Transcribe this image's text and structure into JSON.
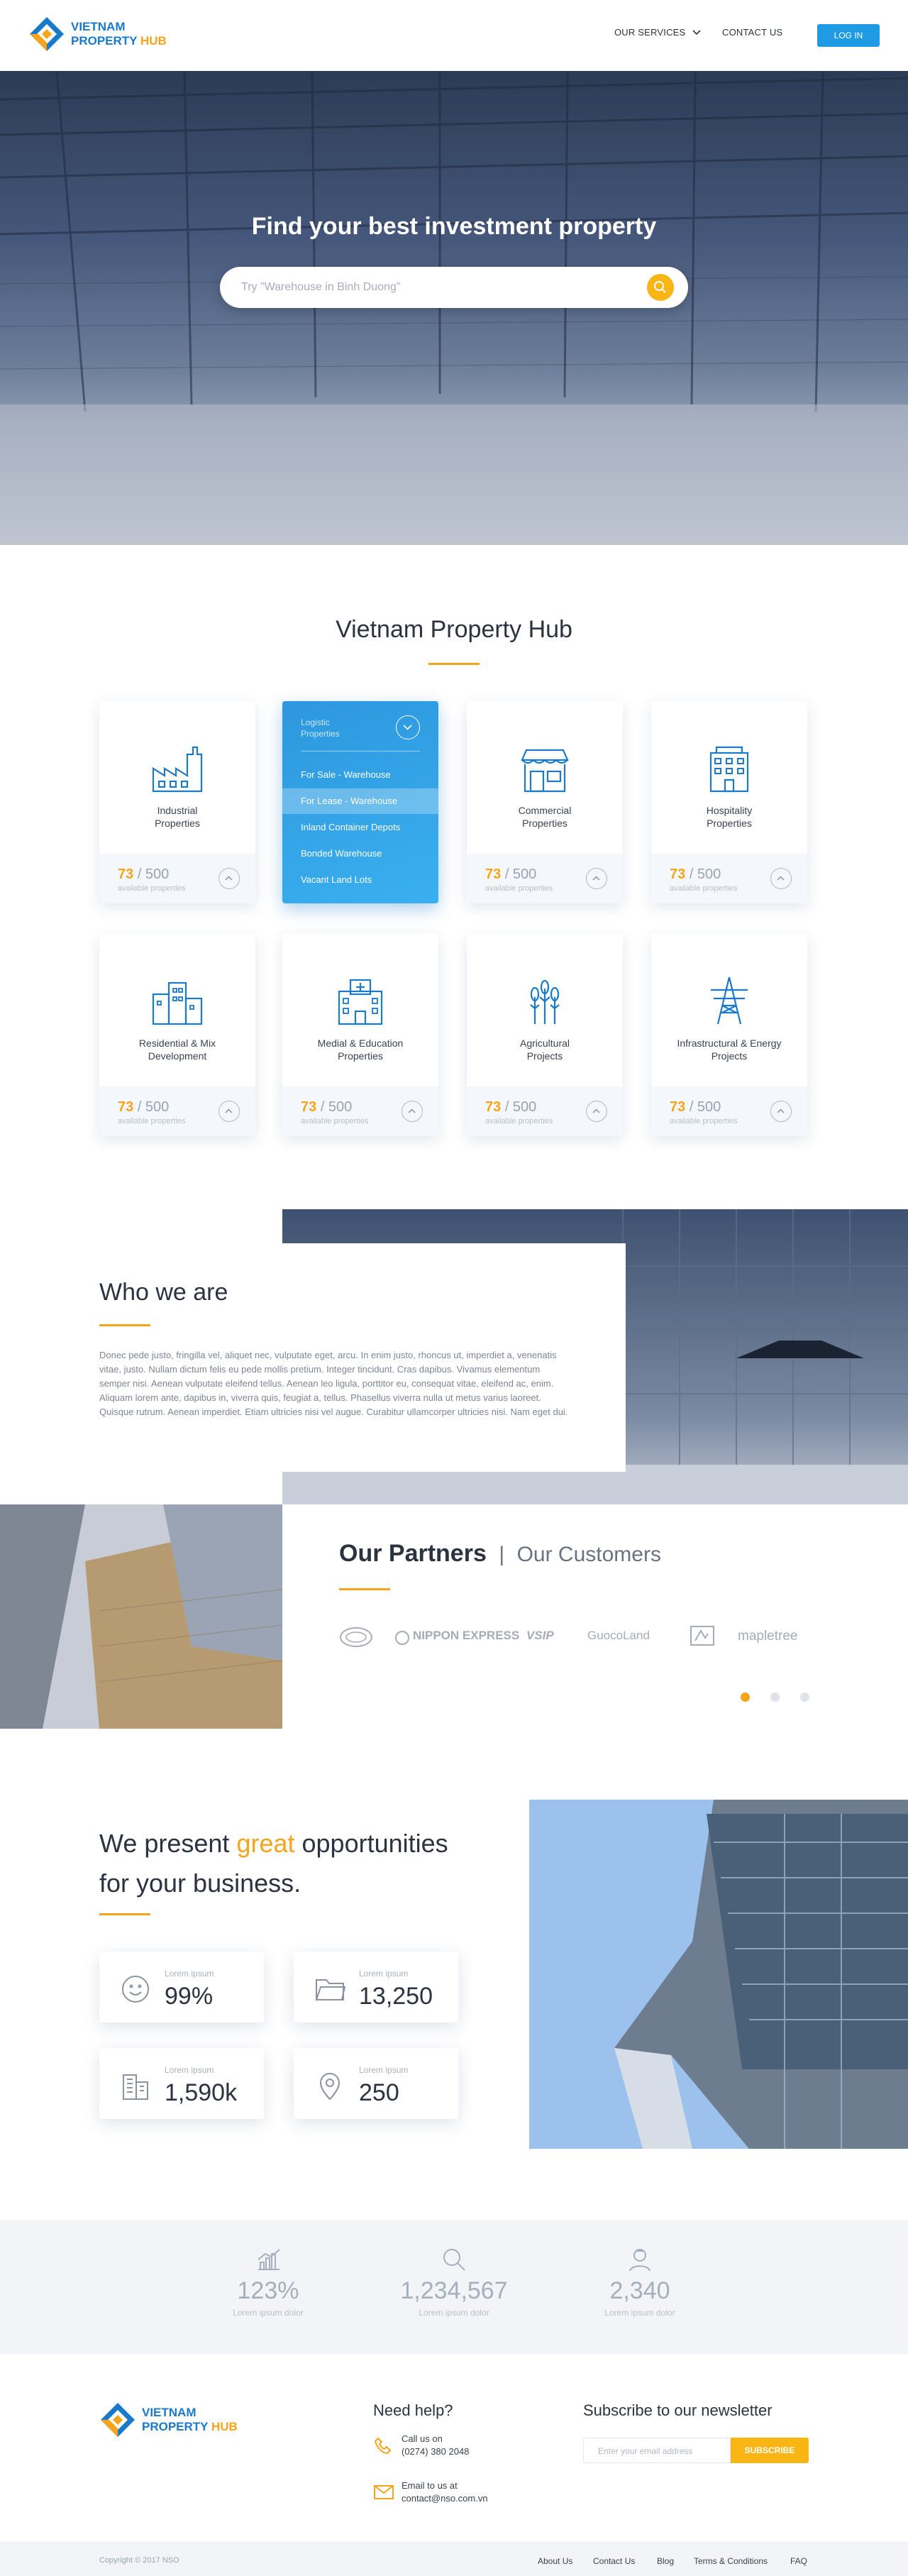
{
  "header": {
    "logo_line1": "VIETNAM",
    "logo_line2a": "PROPERTY",
    "logo_line2b": "HUB",
    "nav_services": "OUR SERVICES",
    "nav_contact": "CONTACT US",
    "login": "LOG IN"
  },
  "hero": {
    "title": "Find your best investment property",
    "search_placeholder": "Try \"Warehouse in Binh Duong\""
  },
  "properties": {
    "title": "Vietnam Property Hub",
    "cards": [
      {
        "name": "Industrial\nProperties",
        "count": "73",
        "total": "/ 500",
        "avail": "available properties",
        "icon": "factory-icon"
      },
      {
        "name": "Commercial\nProperties",
        "count": "73",
        "total": "/ 500",
        "avail": "available properties",
        "icon": "shop-icon"
      },
      {
        "name": "Hospitality\nProperties",
        "count": "73",
        "total": "/ 500",
        "avail": "available properties",
        "icon": "hotel-icon"
      },
      {
        "name": "Residential & Mix\nDevelopment",
        "count": "73",
        "total": "/ 500",
        "avail": "available properties",
        "icon": "residential-icon"
      },
      {
        "name": "Medial & Education\nProperties",
        "count": "73",
        "total": "/ 500",
        "avail": "available properties",
        "icon": "hospital-icon"
      },
      {
        "name": "Agricultural\nProjects",
        "count": "73",
        "total": "/ 500",
        "avail": "available properties",
        "icon": "wheat-icon"
      },
      {
        "name": "Infrastructural & Energy\nProjects",
        "count": "73",
        "total": "/ 500",
        "avail": "available properties",
        "icon": "power-tower-icon"
      }
    ],
    "dropdown": {
      "header": "Logistic\nProperties",
      "items": [
        "For Sale - Warehouse",
        "For Lease - Warehouse",
        "Inland Container Depots",
        "Bonded Warehouse",
        "Vacant Land Lots"
      ],
      "active_index": 1
    }
  },
  "who": {
    "title": "Who we are",
    "body": "Donec pede justo, fringilla vel, aliquet nec, vulputate eget, arcu. In enim justo, rhoncus ut, imperdiet a, venenatis vitae, justo. Nullam dictum felis eu pede mollis pretium. Integer tincidunt. Cras dapibus. Vivamus elementum semper nisi. Aenean vulputate eleifend tellus. Aenean leo ligula, porttitor eu, consequat vitae, eleifend ac, enim. Aliquam lorem ante, dapibus in, viverra quis, feugiat a, tellus. Phasellus viverra nulla ut metus varius laoreet. Quisque rutrum. Aenean imperdiet. Etiam ultricies nisi vel augue. Curabitur ullamcorper ultricies nisi. Nam eget dui."
  },
  "partners": {
    "title": "Our Partners",
    "separator": "|",
    "subtitle": "Our Customers",
    "logos": [
      "NIPPON EXPRESS",
      "VSIP",
      "GuocoLand",
      "mapletree"
    ]
  },
  "opportunities": {
    "line1a": "We present ",
    "line1b": "great",
    "line1c": " opportunities",
    "line2": "for your business.",
    "stats": [
      {
        "label": "Lorem ipsum",
        "value": "99%",
        "icon": "smile-icon"
      },
      {
        "label": "Lorem ipsum",
        "value": "13,250",
        "icon": "folder-icon"
      },
      {
        "label": "Lorem ipsum",
        "value": "1,590k",
        "icon": "buildings-icon"
      },
      {
        "label": "Lorem ipsum",
        "value": "250",
        "icon": "location-pin-icon"
      }
    ]
  },
  "bigstats": [
    {
      "value": "123%",
      "label": "Lorem ipsum dolor",
      "icon": "bar-chart-icon"
    },
    {
      "value": "1,234,567",
      "label": "Lorem ipsum dolor",
      "icon": "magnifier-icon"
    },
    {
      "value": "2,340",
      "label": "Lorem ipsum dolor",
      "icon": "user-icon"
    }
  ],
  "footer": {
    "help_title": "Need help?",
    "call_label": "Call us on",
    "phone": "(0274) 380 2048",
    "email_label": "Email to us at",
    "email": "contact@nso.com.vn",
    "newsletter_title": "Subscribe to our newsletter",
    "newsletter_placeholder": "Enter your email address",
    "subscribe": "SUBSCRIBE",
    "copyright": "Copyright © 2017 NSO",
    "links": [
      "About Us",
      "Contact Us",
      "Blog",
      "Terms & Conditions",
      "FAQ"
    ]
  },
  "colors": {
    "brand_blue": "#1e9be3",
    "accent_orange": "#f5a41c",
    "text_dark": "#2c3340"
  }
}
